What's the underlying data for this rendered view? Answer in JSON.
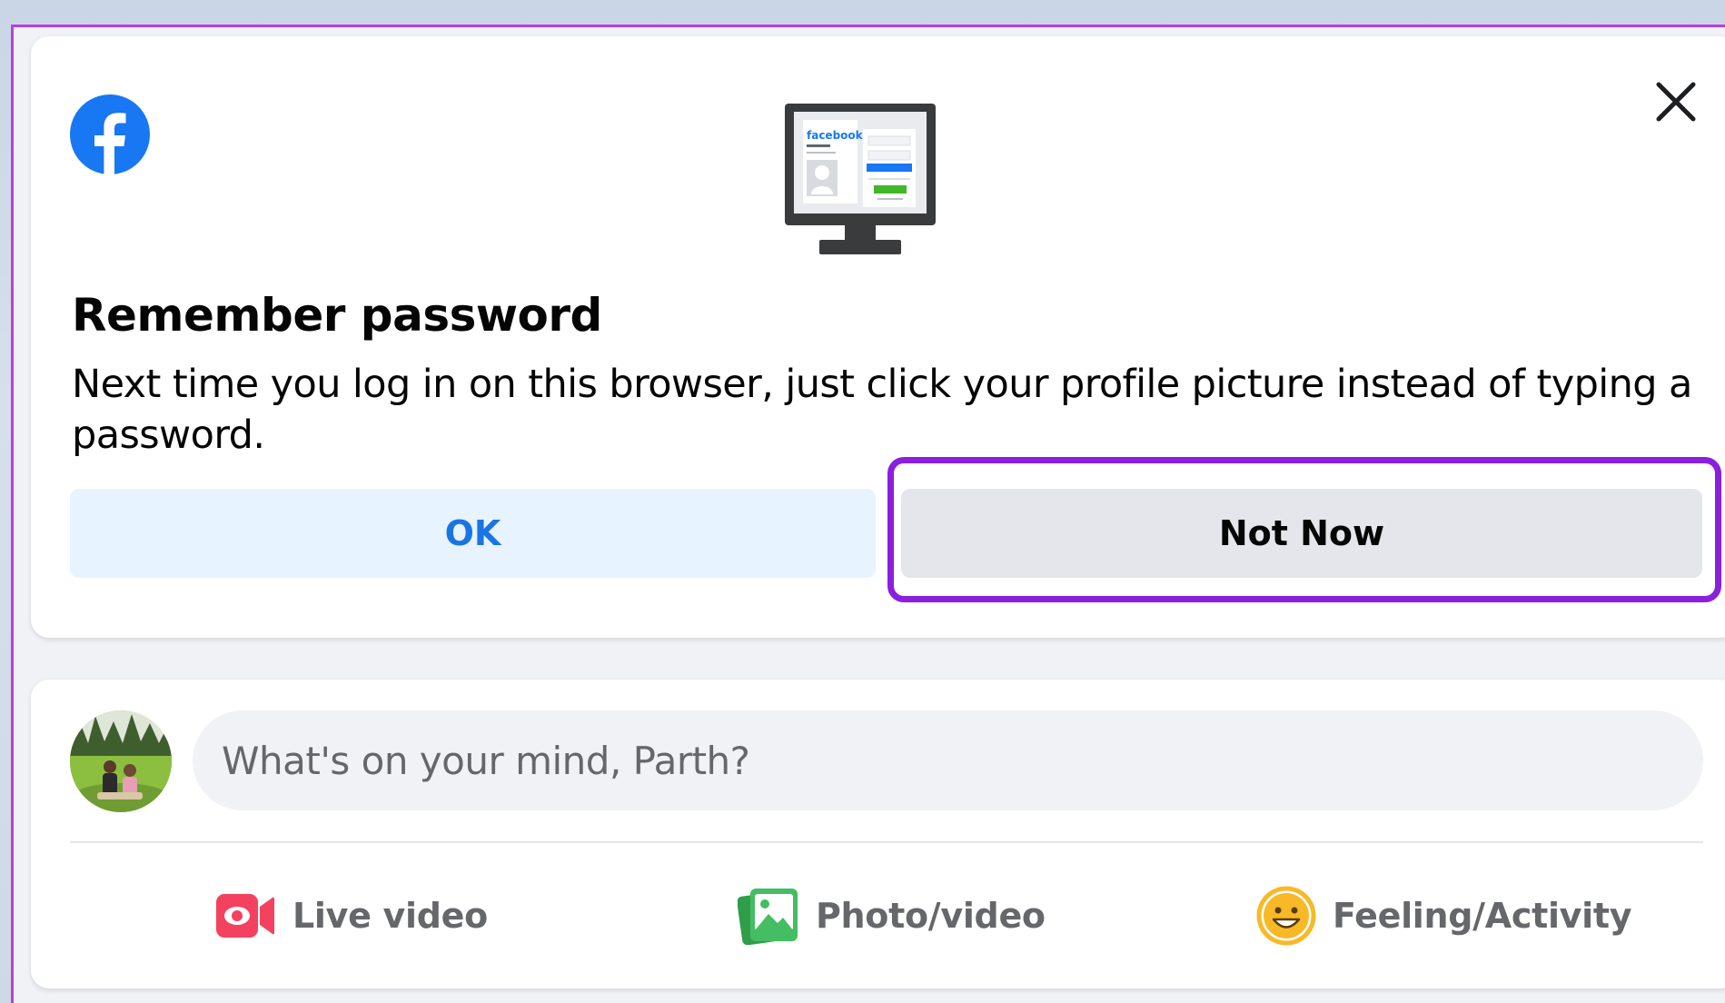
{
  "remember_dialog": {
    "title": "Remember password",
    "description": "Next time you log in on this browser, just click your profile picture instead of typing a password.",
    "ok_label": "OK",
    "not_now_label": "Not Now",
    "monitor_icon_brand": "facebook",
    "icons": {
      "logo": "facebook-logo-icon",
      "close": "close-icon",
      "illustration": "monitor-login-illustration"
    }
  },
  "composer": {
    "placeholder": "What's on your mind, Parth?",
    "actions": [
      {
        "label": "Live video",
        "icon": "live-video-icon",
        "color": "#f3425f"
      },
      {
        "label": "Photo/video",
        "icon": "photo-video-icon",
        "color": "#45bd62"
      },
      {
        "label": "Feeling/Activity",
        "icon": "feeling-activity-icon",
        "color": "#f7b928"
      }
    ]
  },
  "colors": {
    "facebook_blue": "#1877f2",
    "ok_button_bg": "#e7f3ff",
    "not_now_button_bg": "#e4e6eb",
    "highlight": "#8a1fe0"
  }
}
